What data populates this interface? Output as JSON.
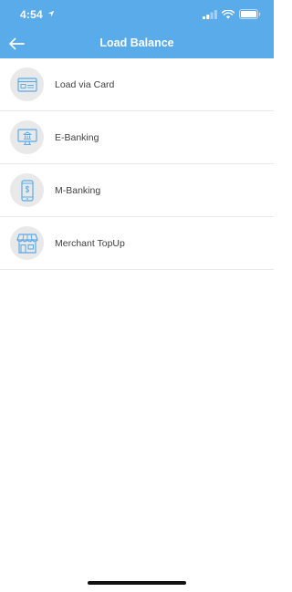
{
  "status_bar": {
    "time": "4:54",
    "location_icon": "location-arrow-icon",
    "signal_icon": "cellular-signal-icon",
    "wifi_icon": "wifi-icon",
    "battery_icon": "battery-icon"
  },
  "nav": {
    "title": "Load Balance",
    "back_icon": "back-arrow-icon"
  },
  "menu": {
    "items": [
      {
        "label": "Load via Card",
        "icon": "credit-card-icon"
      },
      {
        "label": "E-Banking",
        "icon": "computer-bank-icon"
      },
      {
        "label": "M-Banking",
        "icon": "mobile-phone-icon"
      },
      {
        "label": "Merchant TopUp",
        "icon": "storefront-icon"
      }
    ]
  },
  "colors": {
    "header_bg": "#5aabea",
    "icon_stroke": "#5aabea",
    "icon_circle_bg": "#e9e9e9"
  }
}
